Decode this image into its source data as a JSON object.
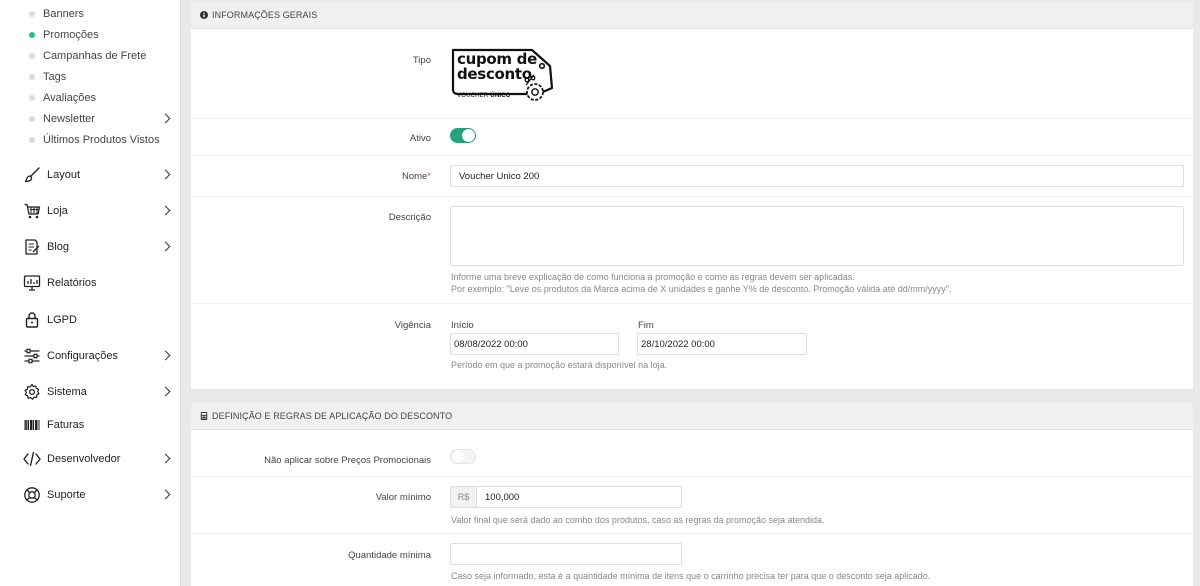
{
  "sidebar": {
    "subitems": [
      {
        "label": "Banners",
        "active": false
      },
      {
        "label": "Promoções",
        "active": true
      },
      {
        "label": "Campanhas de Frete",
        "active": false
      },
      {
        "label": "Tags",
        "active": false
      },
      {
        "label": "Avaliações",
        "active": false
      },
      {
        "label": "Newsletter",
        "active": false
      },
      {
        "label": "Últimos Produtos Vistos",
        "active": false
      }
    ],
    "items": [
      {
        "label": "Layout",
        "icon": "brush-icon"
      },
      {
        "label": "Loja",
        "icon": "cart-icon"
      },
      {
        "label": "Blog",
        "icon": "blog-icon"
      },
      {
        "label": "Relatórios",
        "icon": "reports-icon"
      },
      {
        "label": "LGPD",
        "icon": "lock-icon"
      },
      {
        "label": "Configurações",
        "icon": "sliders-icon"
      },
      {
        "label": "Sistema",
        "icon": "gear-icon"
      },
      {
        "label": "Faturas",
        "icon": "barcode-icon"
      },
      {
        "label": "Desenvolvedor",
        "icon": "code-icon"
      },
      {
        "label": "Suporte",
        "icon": "lifebuoy-icon"
      }
    ]
  },
  "info": {
    "header": "INFORMAÇÕES GERAIS",
    "tipo_label": "Tipo",
    "tipo_badge": {
      "line1": "cupom de",
      "line2": "desconto",
      "sub1": "VOUCHER ",
      "sub2": "ÚNICO"
    },
    "ativo_label": "Ativo",
    "ativo_on": true,
    "nome_label": "Nome",
    "nome_required": "*",
    "nome_value": "Voucher Unico 200",
    "descricao_label": "Descrição",
    "descricao_value": "",
    "descricao_help1": "Informe uma breve explicação de como funciona a promoção e como as regras devem ser aplicadas.",
    "descricao_help2": "Por exemplo: \"Leve os produtos da Marca acima de X unidades e ganhe Y% de desconto. Promoção válida até dd/mm/yyyy\".",
    "vigencia_label": "Vigência",
    "inicio_label": "Início",
    "inicio_value": "08/08/2022 00:00",
    "fim_label": "Fim",
    "fim_value": "28/10/2022 00:00",
    "vigencia_help": "Período em que a promoção estará disponível na loja."
  },
  "rules": {
    "header": "DEFINIÇÃO E REGRAS DE APLICAÇÃO DO DESCONTO",
    "nao_aplicar_label": "Não aplicar sobre Preços Promocionais",
    "nao_aplicar_on": false,
    "valor_minimo_label": "Valor mínimo",
    "currency_prefix": "R$",
    "valor_minimo_value": "100,000",
    "valor_minimo_help": "Valor final que será dado ao combo dos produtos, caso as regras da promoção seja atendida.",
    "quantidade_minima_label": "Quantidade mínima",
    "quantidade_minima_value": "",
    "quantidade_minima_help": "Caso seja informado, esta é a quantidade mínima de itens que o carrinho precisa ter para que o desconto seja aplicado."
  },
  "colors": {
    "accent": "#25a37c",
    "active_dot": "#25c48a",
    "required": "#d9534f"
  }
}
